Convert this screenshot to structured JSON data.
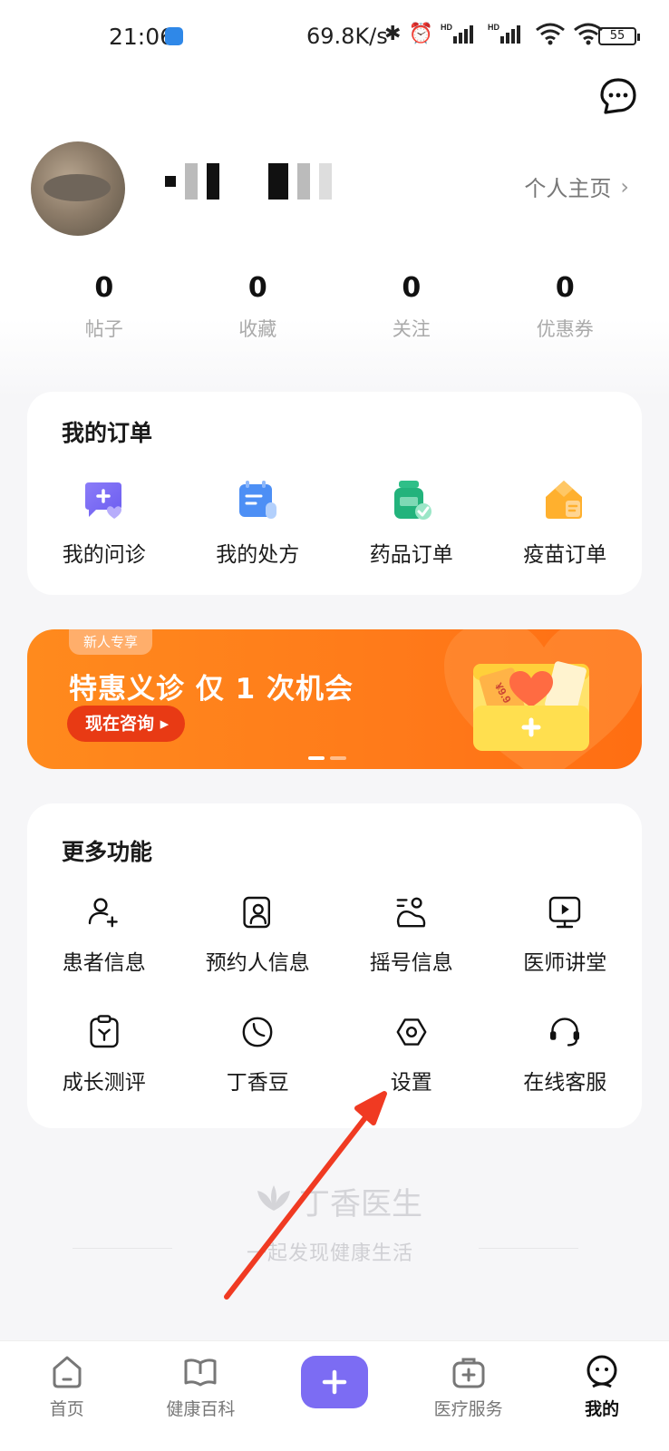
{
  "status_bar": {
    "time": "21:06",
    "net_speed": "69.8K/s",
    "hd1": "HD",
    "hd2": "HD",
    "battery": "55"
  },
  "profile": {
    "homepage_link": "个人主页",
    "stats": [
      {
        "value": "0",
        "label": "帖子"
      },
      {
        "value": "0",
        "label": "收藏"
      },
      {
        "value": "0",
        "label": "关注"
      },
      {
        "value": "0",
        "label": "优惠券"
      }
    ]
  },
  "orders": {
    "title": "我的订单",
    "items": [
      {
        "label": "我的问诊",
        "icon": "consult-icon"
      },
      {
        "label": "我的处方",
        "icon": "prescription-icon"
      },
      {
        "label": "药品订单",
        "icon": "medicine-icon"
      },
      {
        "label": "疫苗订单",
        "icon": "vaccine-icon"
      }
    ]
  },
  "banner": {
    "tag": "新人专享",
    "headline": "特惠义诊  仅 1 次机会",
    "cta": "现在咨询 ▸",
    "ticket": "¥9.9"
  },
  "more": {
    "title": "更多功能",
    "items": [
      {
        "label": "患者信息",
        "icon": "patient-add-icon"
      },
      {
        "label": "预约人信息",
        "icon": "appointment-person-icon"
      },
      {
        "label": "摇号信息",
        "icon": "lottery-icon"
      },
      {
        "label": "医师讲堂",
        "icon": "lecture-video-icon"
      },
      {
        "label": "成长测评",
        "icon": "growth-test-icon"
      },
      {
        "label": "丁香豆",
        "icon": "bean-icon"
      },
      {
        "label": "设置",
        "icon": "settings-icon"
      },
      {
        "label": "在线客服",
        "icon": "headset-icon"
      }
    ]
  },
  "slogan": {
    "brand": "丁香医生",
    "sub": "一起发现健康生活"
  },
  "bottom_nav": [
    {
      "label": "首页",
      "icon": "home-icon"
    },
    {
      "label": "健康百科",
      "icon": "book-icon"
    },
    {
      "label": "",
      "icon": "plus-icon"
    },
    {
      "label": "医疗服务",
      "icon": "medical-kit-icon"
    },
    {
      "label": "我的",
      "icon": "profile-icon",
      "active": true
    }
  ],
  "colors": {
    "accent": "#7c6cf3",
    "banner": "#ff7a1a",
    "arrow": "#f03a22"
  }
}
